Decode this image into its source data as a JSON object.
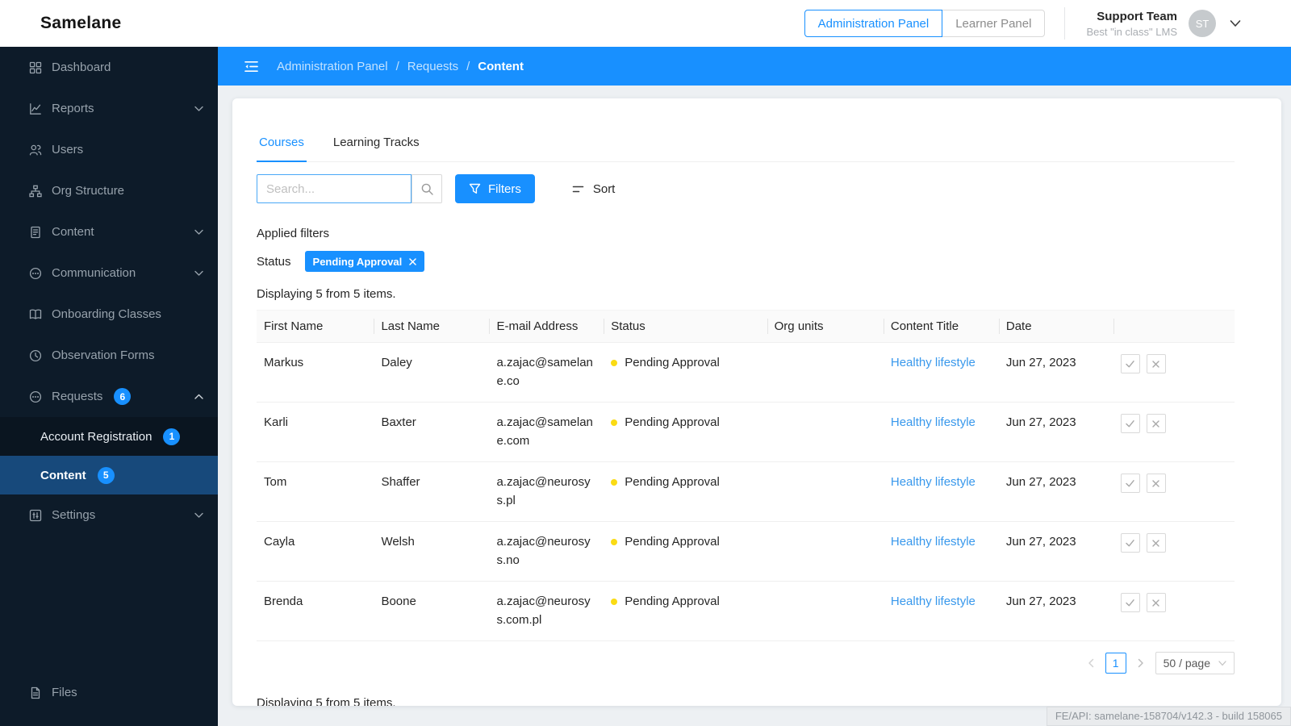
{
  "colors": {
    "accent": "#1890ff",
    "sidebar_bg": "#0d1b29",
    "sidebar_selected_bg": "#17497b",
    "status_dot": "#fadb14",
    "link": "#3898ec"
  },
  "header": {
    "logo": "Samelane",
    "admin_panel_button": "Administration Panel",
    "learner_panel_button": "Learner Panel",
    "user_name": "Support Team",
    "user_subtitle": "Best \"in class\" LMS",
    "avatar_initials": "ST"
  },
  "breadcrumb": {
    "sep": "/",
    "items": [
      "Administration Panel",
      "Requests",
      "Content"
    ]
  },
  "sidebar": {
    "items": [
      {
        "label": "Dashboard"
      },
      {
        "label": "Reports"
      },
      {
        "label": "Users"
      },
      {
        "label": "Org Structure"
      },
      {
        "label": "Content"
      },
      {
        "label": "Communication"
      },
      {
        "label": "Onboarding Classes"
      },
      {
        "label": "Observation Forms"
      },
      {
        "label": "Requests",
        "badge": "6"
      }
    ],
    "submenu": [
      {
        "label": "Account Registration",
        "badge": "1"
      },
      {
        "label": "Content",
        "badge": "5"
      }
    ],
    "settings": {
      "label": "Settings"
    },
    "files": {
      "label": "Files"
    }
  },
  "main": {
    "tabs": [
      {
        "label": "Courses"
      },
      {
        "label": "Learning Tracks"
      }
    ],
    "search_placeholder": "Search...",
    "filters_button": "Filters",
    "sort_label": "Sort",
    "applied_filters_title": "Applied filters",
    "status_filter_label": "Status",
    "status_chip": "Pending Approval",
    "items_count": "Displaying 5 from 5 items.",
    "table": {
      "columns": [
        "First Name",
        "Last Name",
        "E-mail Address",
        "Status",
        "Org units",
        "Content Title",
        "Date"
      ],
      "rows": [
        {
          "first_name": "Markus",
          "last_name": "Daley",
          "email": "a.zajac@samelane.co",
          "status": "Pending Approval",
          "org_units": "",
          "content_title": "Healthy lifestyle",
          "date": "Jun 27, 2023"
        },
        {
          "first_name": "Karli",
          "last_name": "Baxter",
          "email": "a.zajac@samelane.com",
          "status": "Pending Approval",
          "org_units": "",
          "content_title": "Healthy lifestyle",
          "date": "Jun 27, 2023"
        },
        {
          "first_name": "Tom",
          "last_name": "Shaffer",
          "email": "a.zajac@neurosys.pl",
          "status": "Pending Approval",
          "org_units": "",
          "content_title": "Healthy lifestyle",
          "date": "Jun 27, 2023"
        },
        {
          "first_name": "Cayla",
          "last_name": "Welsh",
          "email": "a.zajac@neurosys.no",
          "status": "Pending Approval",
          "org_units": "",
          "content_title": "Healthy lifestyle",
          "date": "Jun 27, 2023"
        },
        {
          "first_name": "Brenda",
          "last_name": "Boone",
          "email": "a.zajac@neurosys.com.pl",
          "status": "Pending Approval",
          "org_units": "",
          "content_title": "Healthy lifestyle",
          "date": "Jun 27, 2023"
        }
      ]
    },
    "pagination": {
      "current_page": "1",
      "page_size": "50 / page"
    }
  },
  "footer": {
    "version_info": "FE/API: samelane-158704/v142.3 - build 158065"
  }
}
